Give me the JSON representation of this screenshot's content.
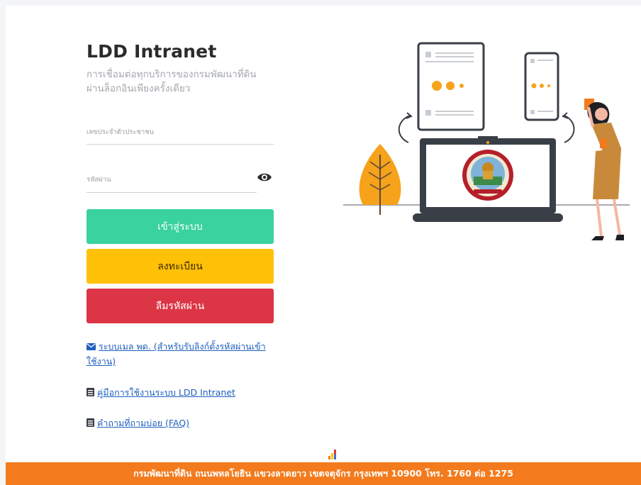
{
  "app": {
    "title": "LDD Intranet",
    "subtitle_line1": "การเชื่อมต่อทุกบริการของกรมพัฒนาที่ดิน",
    "subtitle_line2": "ผ่านล็อกอินเพียงครั้งเดียว"
  },
  "form": {
    "idcard": {
      "placeholder": "เลขประจำตัวประชาชน",
      "value": ""
    },
    "password": {
      "placeholder": "รหัสผ่าน",
      "value": ""
    },
    "eye_icon": "eye-icon"
  },
  "buttons": {
    "login": "เข้าสู่ระบบ",
    "register": "ลงทะเบียน",
    "forgot": "ลืมรหัสผ่าน"
  },
  "links": {
    "mail": "ระบบเมล พด. (สำหรับรับลิงก์ตั้งรหัสผ่านเข้าใช้งาน)",
    "manual": "คู่มือการใช้งานระบบ LDD Intranet",
    "faq": "คำถามที่ถามบ่อย (FAQ)"
  },
  "footer": {
    "text": "กรมพัฒนาที่ดิน ถนนพหลโยธิน แขวงลาดยาว เขตจตุจักร กรุงเทพฯ 10900 โทร. 1760 ต่อ 1275"
  },
  "colors": {
    "login": "#3ad29f",
    "register": "#ffc107",
    "forgot": "#dc3545",
    "footer": "#f37b1d",
    "link": "#1f5fbf"
  }
}
